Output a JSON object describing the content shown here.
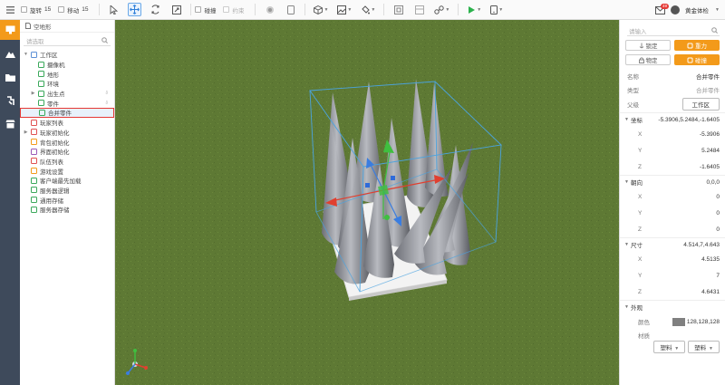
{
  "toolbar": {
    "rotate": {
      "label": "旋转",
      "value": "15"
    },
    "move": {
      "label": "移动",
      "value": "15"
    },
    "snap_label": "碰撞",
    "constraint_label": "约束"
  },
  "user": {
    "name": "黄金体检",
    "notifications": "49"
  },
  "explorer": {
    "tab_label": "空地形",
    "search_placeholder": "请选取",
    "tree": [
      {
        "label": "工作区",
        "depth": 0,
        "toggle": "v",
        "icon": "folder-icon",
        "color": "#5b8fd6"
      },
      {
        "label": "摄像机",
        "depth": 1,
        "toggle": "",
        "icon": "camera-icon",
        "color": "#3aa85a"
      },
      {
        "label": "地形",
        "depth": 1,
        "toggle": "",
        "icon": "terrain-icon",
        "color": "#3aa85a"
      },
      {
        "label": "环境",
        "depth": 1,
        "toggle": "",
        "icon": "environment-icon",
        "color": "#3aa85a"
      },
      {
        "label": "出生点",
        "depth": 1,
        "toggle": ">",
        "icon": "spawn-icon",
        "color": "#3aa85a",
        "right": "⇩"
      },
      {
        "label": "零件",
        "depth": 1,
        "toggle": "",
        "icon": "part-icon",
        "color": "#3aa85a",
        "right": "⇩"
      },
      {
        "label": "合并零件",
        "depth": 1,
        "toggle": "",
        "icon": "merged-part-icon",
        "color": "#3aa85a",
        "selected": true
      },
      {
        "label": "玩家列表",
        "depth": 0,
        "toggle": "",
        "icon": "player-list-icon",
        "color": "#e05050"
      },
      {
        "label": "玩家初始化",
        "depth": 0,
        "toggle": ">",
        "icon": "player-init-icon",
        "color": "#e05050"
      },
      {
        "label": "背包初始化",
        "depth": 0,
        "toggle": "",
        "icon": "backpack-icon",
        "color": "#f39a1a"
      },
      {
        "label": "界面初始化",
        "depth": 0,
        "toggle": "",
        "icon": "ui-init-icon",
        "color": "#9b59b6"
      },
      {
        "label": "队伍列表",
        "depth": 0,
        "toggle": "",
        "icon": "team-list-icon",
        "color": "#e05050"
      },
      {
        "label": "游戏设置",
        "depth": 0,
        "toggle": "",
        "icon": "game-settings-icon",
        "color": "#f39a1a"
      },
      {
        "label": "客户端最先加载",
        "depth": 0,
        "toggle": "",
        "icon": "client-load-icon",
        "color": "#3aa85a"
      },
      {
        "label": "服务器逻辑",
        "depth": 0,
        "toggle": "",
        "icon": "server-logic-icon",
        "color": "#3aa85a"
      },
      {
        "label": "通用存储",
        "depth": 0,
        "toggle": "",
        "icon": "common-storage-icon",
        "color": "#3aa85a"
      },
      {
        "label": "服务器存储",
        "depth": 0,
        "toggle": "",
        "icon": "server-storage-icon",
        "color": "#3aa85a"
      }
    ]
  },
  "props": {
    "search_placeholder": "请输入",
    "buttons": {
      "lock": "锁定",
      "gravity": "重力",
      "anchor": "物定",
      "collision": "碰撞"
    },
    "name": {
      "label": "名称",
      "value": "合并零件"
    },
    "type": {
      "label": "类型",
      "value": "合并零件"
    },
    "parent": {
      "label": "父级",
      "value": "工作区"
    },
    "position": {
      "label": "坐标",
      "summary": "-5.3906,5.2484,-1.6405",
      "x": "-5.3906",
      "y": "5.2484",
      "z": "-1.6405"
    },
    "rotation": {
      "label": "朝向",
      "summary": "0,0,0",
      "x": "0",
      "y": "0",
      "z": "0"
    },
    "size": {
      "label": "尺寸",
      "summary": "4.514,7,4.643",
      "x": "4.5135",
      "y": "7",
      "z": "4.6431"
    },
    "appearance": {
      "label": "外观",
      "color_label": "颜色",
      "color_value": "128,128,128",
      "color_hex": "#808080",
      "material_label": "材质",
      "material_value": "塑料",
      "material_value2": "塑料"
    },
    "axis": {
      "x": "X",
      "y": "Y",
      "z": "Z"
    }
  }
}
